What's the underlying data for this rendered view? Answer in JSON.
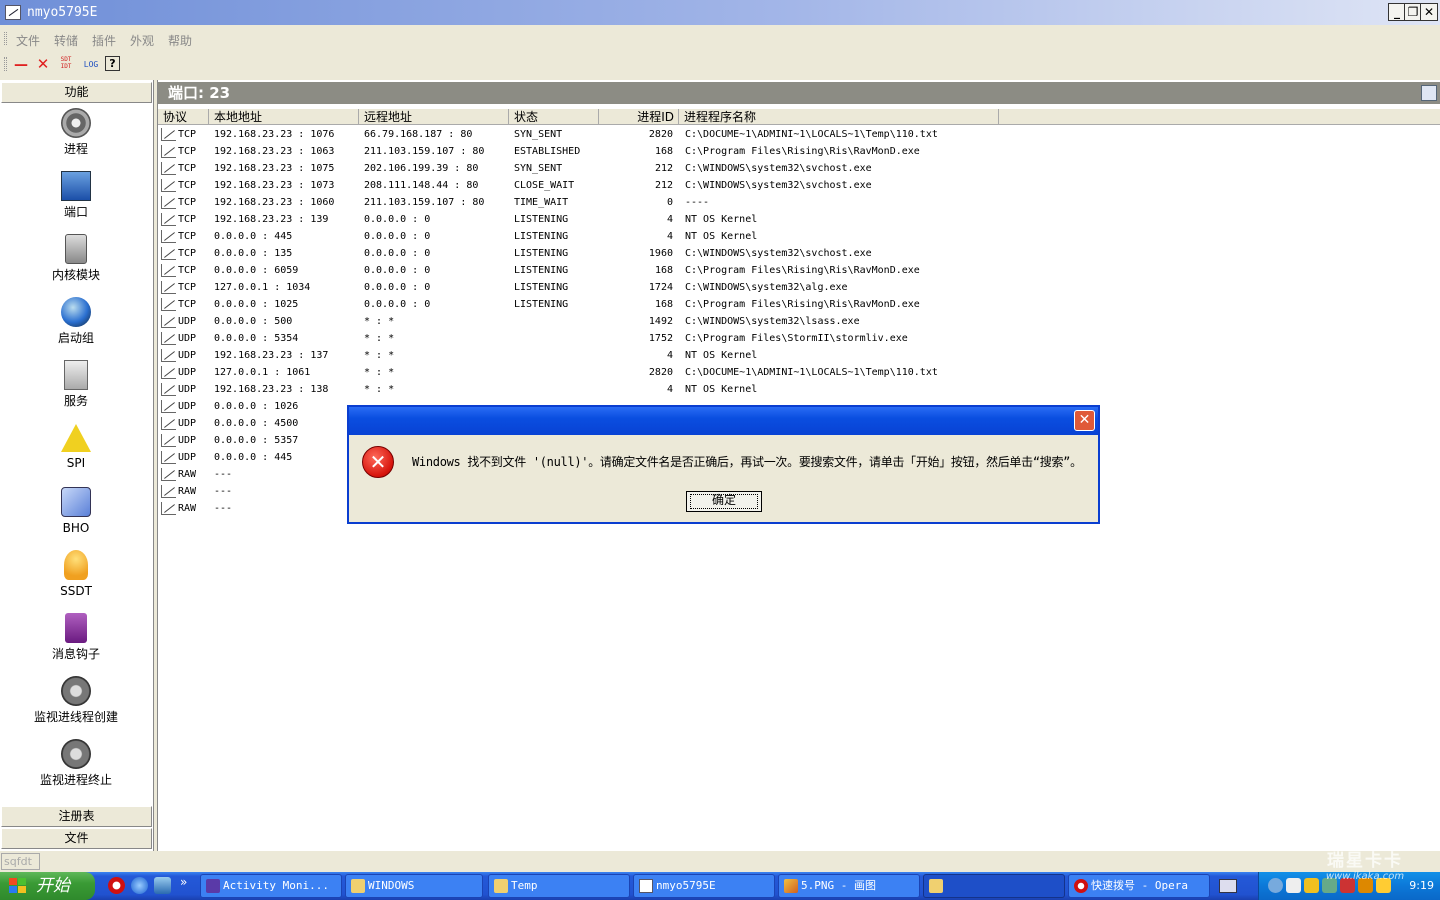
{
  "window": {
    "title": "nmyo5795E"
  },
  "menu": [
    "文件",
    "转储",
    "插件",
    "外观",
    "帮助"
  ],
  "toolbar": {
    "minus": "—",
    "close": "✕",
    "log": "LOG",
    "help": "?",
    "sdt_top": "SDT",
    "sdt_bottom": "IDT"
  },
  "left_panel": {
    "header": "功能",
    "items": [
      "进程",
      "端口",
      "内核模块",
      "启动组",
      "服务",
      "SPI",
      "BHO",
      "SSDT",
      "消息钩子",
      "监视进线程创建",
      "监视进程终止"
    ],
    "footer": [
      "注册表",
      "文件"
    ]
  },
  "main": {
    "port_title": "端口: 23",
    "columns": [
      "协议",
      "本地地址",
      "远程地址",
      "状态",
      "进程ID",
      "进程程序名称"
    ],
    "rows": [
      {
        "proto": "TCP",
        "local": "192.168.23.23 : 1076",
        "remote": "66.79.168.187 : 80",
        "state": "SYN_SENT",
        "pid": "2820",
        "path": "C:\\DOCUME~1\\ADMINI~1\\LOCALS~1\\Temp\\110.txt"
      },
      {
        "proto": "TCP",
        "local": "192.168.23.23 : 1063",
        "remote": "211.103.159.107 : 80",
        "state": "ESTABLISHED",
        "pid": "168",
        "path": "C:\\Program Files\\Rising\\Ris\\RavMonD.exe"
      },
      {
        "proto": "TCP",
        "local": "192.168.23.23 : 1075",
        "remote": "202.106.199.39 : 80",
        "state": "SYN_SENT",
        "pid": "212",
        "path": "C:\\WINDOWS\\system32\\svchost.exe"
      },
      {
        "proto": "TCP",
        "local": "192.168.23.23 : 1073",
        "remote": "208.111.148.44 : 80",
        "state": "CLOSE_WAIT",
        "pid": "212",
        "path": "C:\\WINDOWS\\system32\\svchost.exe"
      },
      {
        "proto": "TCP",
        "local": "192.168.23.23 : 1060",
        "remote": "211.103.159.107 : 80",
        "state": "TIME_WAIT",
        "pid": "0",
        "path": "----"
      },
      {
        "proto": "TCP",
        "local": "192.168.23.23 : 139",
        "remote": "0.0.0.0 : 0",
        "state": "LISTENING",
        "pid": "4",
        "path": "NT OS Kernel"
      },
      {
        "proto": "TCP",
        "local": "0.0.0.0 : 445",
        "remote": "0.0.0.0 : 0",
        "state": "LISTENING",
        "pid": "4",
        "path": "NT OS Kernel"
      },
      {
        "proto": "TCP",
        "local": "0.0.0.0 : 135",
        "remote": "0.0.0.0 : 0",
        "state": "LISTENING",
        "pid": "1960",
        "path": "C:\\WINDOWS\\system32\\svchost.exe"
      },
      {
        "proto": "TCP",
        "local": "0.0.0.0 : 6059",
        "remote": "0.0.0.0 : 0",
        "state": "LISTENING",
        "pid": "168",
        "path": "C:\\Program Files\\Rising\\Ris\\RavMonD.exe"
      },
      {
        "proto": "TCP",
        "local": "127.0.0.1 : 1034",
        "remote": "0.0.0.0 : 0",
        "state": "LISTENING",
        "pid": "1724",
        "path": "C:\\WINDOWS\\system32\\alg.exe"
      },
      {
        "proto": "TCP",
        "local": "0.0.0.0 : 1025",
        "remote": "0.0.0.0 : 0",
        "state": "LISTENING",
        "pid": "168",
        "path": "C:\\Program Files\\Rising\\Ris\\RavMonD.exe"
      },
      {
        "proto": "UDP",
        "local": "0.0.0.0 : 500",
        "remote": "* : *",
        "state": "",
        "pid": "1492",
        "path": "C:\\WINDOWS\\system32\\lsass.exe"
      },
      {
        "proto": "UDP",
        "local": "0.0.0.0 : 5354",
        "remote": "* : *",
        "state": "",
        "pid": "1752",
        "path": "C:\\Program Files\\StormII\\stormliv.exe"
      },
      {
        "proto": "UDP",
        "local": "192.168.23.23 : 137",
        "remote": "* : *",
        "state": "",
        "pid": "4",
        "path": "NT OS Kernel"
      },
      {
        "proto": "UDP",
        "local": "127.0.0.1 : 1061",
        "remote": "* : *",
        "state": "",
        "pid": "2820",
        "path": "C:\\DOCUME~1\\ADMINI~1\\LOCALS~1\\Temp\\110.txt"
      },
      {
        "proto": "UDP",
        "local": "192.168.23.23 : 138",
        "remote": "* : *",
        "state": "",
        "pid": "4",
        "path": "NT OS Kernel"
      },
      {
        "proto": "UDP",
        "local": "0.0.0.0 : 1026",
        "remote": "",
        "state": "",
        "pid": "",
        "path": ""
      },
      {
        "proto": "UDP",
        "local": "0.0.0.0 : 4500",
        "remote": "",
        "state": "",
        "pid": "",
        "path": ""
      },
      {
        "proto": "UDP",
        "local": "0.0.0.0 : 5357",
        "remote": "",
        "state": "",
        "pid": "",
        "path": ""
      },
      {
        "proto": "UDP",
        "local": "0.0.0.0 : 445",
        "remote": "",
        "state": "",
        "pid": "",
        "path": ""
      },
      {
        "proto": "RAW",
        "local": "---",
        "remote": "",
        "state": "",
        "pid": "",
        "path": ""
      },
      {
        "proto": "RAW",
        "local": "---",
        "remote": "",
        "state": "",
        "pid": "",
        "path": ""
      },
      {
        "proto": "RAW",
        "local": "---",
        "remote": "",
        "state": "",
        "pid": "",
        "path": ""
      }
    ]
  },
  "dialog": {
    "message": "Windows 找不到文件 '(null)'。请确定文件名是否正确后，再试一次。要搜索文件，请单击「开始」按钮，然后单击“搜索”。",
    "ok_label": "确定",
    "close_glyph": "✕",
    "error_glyph": "✕"
  },
  "statusbar": {
    "text": "sqfdt"
  },
  "taskbar": {
    "start_label": "开始",
    "more": "»",
    "tasks": [
      "Activity Moni...",
      "WINDOWS",
      "Temp",
      "nmyo5795E",
      "5.PNG - 画图",
      "",
      "快速拨号 - Opera"
    ],
    "clock": "9:19"
  },
  "watermark": {
    "line1": "瑞星卡卡",
    "line2": "www.ikaka.com"
  }
}
